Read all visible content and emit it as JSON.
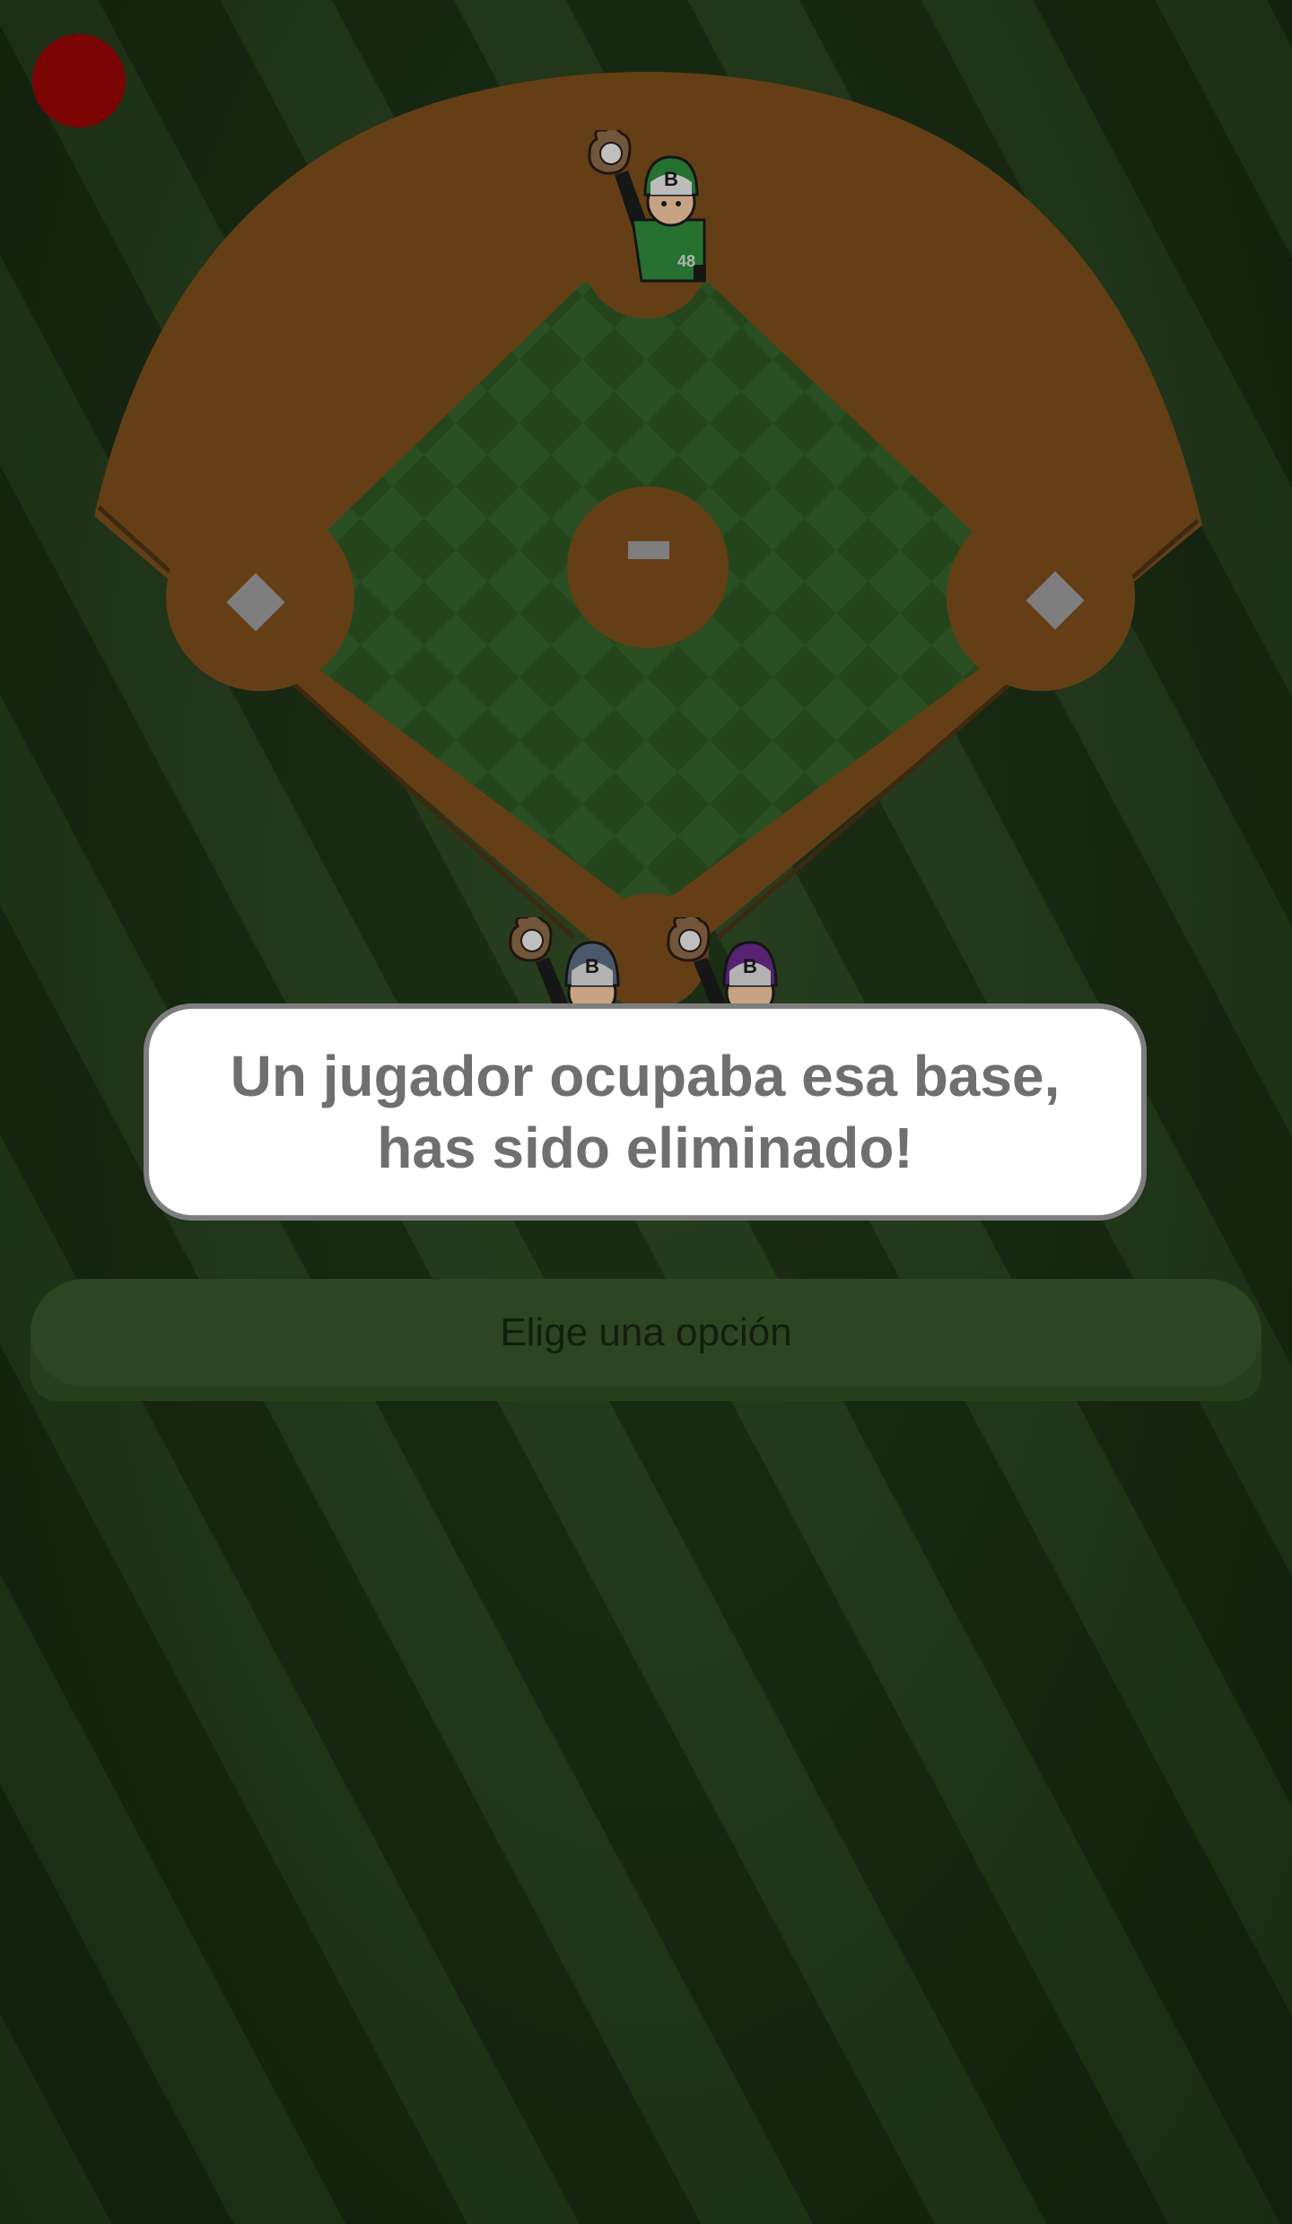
{
  "message": {
    "line1": "Un jugador ocupaba esa base,",
    "line2": "has sido eliminado!"
  },
  "choice": {
    "label": "Elige una opción"
  },
  "players": [
    {
      "id": "center-fielder",
      "cap_letter": "B",
      "jersey_number": "48",
      "cap_color": "#2f8a3a"
    },
    {
      "id": "catcher-left",
      "cap_letter": "B",
      "cap_color": "#5c6c80"
    },
    {
      "id": "catcher-right",
      "cap_letter": "B",
      "cap_color": "#6a2a8a"
    }
  ],
  "colors": {
    "dirt": "#7a4d1c",
    "infield_grass": "#2f5a25",
    "menu_button": "#7a0404",
    "dialog_border": "#7e7e7e",
    "dialog_text": "#6f6f6f"
  }
}
